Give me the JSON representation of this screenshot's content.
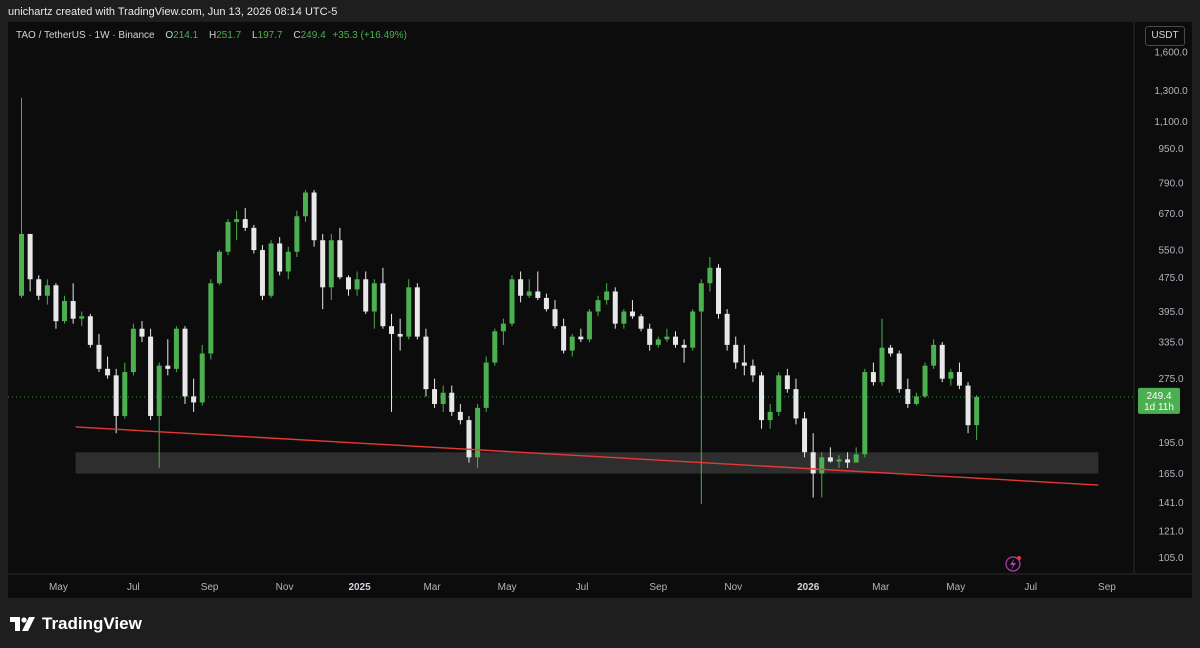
{
  "header": {
    "attribution": "unichartz created with TradingView.com, Jun 13, 2026 08:14 UTC-5"
  },
  "legend": {
    "symbol": "TAO / TetherUS · 1W · Binance",
    "open_label": "O",
    "open_value": "214.1",
    "high_label": "H",
    "high_value": "251.7",
    "low_label": "L",
    "low_value": "197.7",
    "close_label": "C",
    "close_value": "249.4",
    "change": "+35.3 (+16.49%)"
  },
  "currency_button": "USDT",
  "price_tag": {
    "price": "249.4",
    "countdown": "1d 11h"
  },
  "footer": {
    "brand": "TradingView"
  },
  "colors": {
    "up": "#4caf50",
    "down": "#e8e8e8",
    "trendline": "#e53935",
    "zone": "#3a3a3a",
    "last_price_line": "#4caf50"
  },
  "chart_data": {
    "type": "candlestick",
    "scale": "log",
    "timeframe": "1W",
    "ylim": [
      96,
      1880
    ],
    "y_ticks": [
      "1,600.0",
      "1,300.0",
      "1,100.0",
      "950.0",
      "790.0",
      "670.0",
      "550.0",
      "475.0",
      "395.0",
      "335.0",
      "275.0",
      "195.0",
      "165.0",
      "141.0",
      "121.0",
      "105.0"
    ],
    "x_ticks": [
      {
        "label": "May",
        "date": "2024-05-01",
        "bold": false
      },
      {
        "label": "Jul",
        "date": "2024-07-01",
        "bold": false
      },
      {
        "label": "Sep",
        "date": "2024-09-01",
        "bold": false
      },
      {
        "label": "Nov",
        "date": "2024-11-01",
        "bold": false
      },
      {
        "label": "2025",
        "date": "2025-01-01",
        "bold": true
      },
      {
        "label": "Mar",
        "date": "2025-03-01",
        "bold": false
      },
      {
        "label": "May",
        "date": "2025-05-01",
        "bold": false
      },
      {
        "label": "Jul",
        "date": "2025-07-01",
        "bold": false
      },
      {
        "label": "Sep",
        "date": "2025-09-01",
        "bold": false
      },
      {
        "label": "Nov",
        "date": "2025-11-01",
        "bold": false
      },
      {
        "label": "2026",
        "date": "2026-01-01",
        "bold": true
      },
      {
        "label": "Mar",
        "date": "2026-03-01",
        "bold": false
      },
      {
        "label": "May",
        "date": "2026-05-01",
        "bold": false
      },
      {
        "label": "Jul",
        "date": "2026-07-01",
        "bold": false
      },
      {
        "label": "Sep",
        "date": "2026-09-01",
        "bold": false
      }
    ],
    "xlim": [
      "2024-03-21",
      "2026-09-23"
    ],
    "last_price": 249.4,
    "candles": [
      {
        "date": "2024-04-01",
        "o": 430,
        "h": 1250,
        "l": 425,
        "c": 600
      },
      {
        "date": "2024-04-08",
        "o": 600,
        "h": 600,
        "l": 440,
        "c": 470
      },
      {
        "date": "2024-04-15",
        "o": 470,
        "h": 480,
        "l": 420,
        "c": 430
      },
      {
        "date": "2024-04-22",
        "o": 430,
        "h": 470,
        "l": 410,
        "c": 455
      },
      {
        "date": "2024-04-29",
        "o": 455,
        "h": 460,
        "l": 360,
        "c": 375
      },
      {
        "date": "2024-05-06",
        "o": 375,
        "h": 430,
        "l": 370,
        "c": 418
      },
      {
        "date": "2024-05-13",
        "o": 418,
        "h": 460,
        "l": 370,
        "c": 380
      },
      {
        "date": "2024-05-20",
        "o": 380,
        "h": 395,
        "l": 365,
        "c": 385
      },
      {
        "date": "2024-05-27",
        "o": 385,
        "h": 390,
        "l": 325,
        "c": 330
      },
      {
        "date": "2024-06-03",
        "o": 330,
        "h": 350,
        "l": 285,
        "c": 290
      },
      {
        "date": "2024-06-10",
        "o": 290,
        "h": 310,
        "l": 275,
        "c": 280
      },
      {
        "date": "2024-06-17",
        "o": 280,
        "h": 290,
        "l": 205,
        "c": 225
      },
      {
        "date": "2024-06-24",
        "o": 225,
        "h": 300,
        "l": 222,
        "c": 285
      },
      {
        "date": "2024-07-01",
        "o": 285,
        "h": 370,
        "l": 280,
        "c": 360
      },
      {
        "date": "2024-07-08",
        "o": 360,
        "h": 375,
        "l": 335,
        "c": 345
      },
      {
        "date": "2024-07-15",
        "o": 345,
        "h": 360,
        "l": 220,
        "c": 225
      },
      {
        "date": "2024-07-22",
        "o": 225,
        "h": 300,
        "l": 170,
        "c": 295
      },
      {
        "date": "2024-07-29",
        "o": 295,
        "h": 340,
        "l": 280,
        "c": 290
      },
      {
        "date": "2024-08-05",
        "o": 290,
        "h": 365,
        "l": 285,
        "c": 360
      },
      {
        "date": "2024-08-12",
        "o": 360,
        "h": 365,
        "l": 240,
        "c": 250
      },
      {
        "date": "2024-08-19",
        "o": 250,
        "h": 275,
        "l": 230,
        "c": 242
      },
      {
        "date": "2024-08-26",
        "o": 242,
        "h": 330,
        "l": 238,
        "c": 315
      },
      {
        "date": "2024-09-02",
        "o": 315,
        "h": 470,
        "l": 305,
        "c": 460
      },
      {
        "date": "2024-09-09",
        "o": 460,
        "h": 550,
        "l": 455,
        "c": 545
      },
      {
        "date": "2024-09-16",
        "o": 545,
        "h": 650,
        "l": 535,
        "c": 640
      },
      {
        "date": "2024-09-23",
        "o": 640,
        "h": 680,
        "l": 580,
        "c": 650
      },
      {
        "date": "2024-09-30",
        "o": 650,
        "h": 690,
        "l": 610,
        "c": 620
      },
      {
        "date": "2024-10-07",
        "o": 620,
        "h": 630,
        "l": 540,
        "c": 550
      },
      {
        "date": "2024-10-14",
        "o": 550,
        "h": 565,
        "l": 420,
        "c": 430
      },
      {
        "date": "2024-10-21",
        "o": 430,
        "h": 580,
        "l": 425,
        "c": 570
      },
      {
        "date": "2024-10-28",
        "o": 570,
        "h": 590,
        "l": 480,
        "c": 490
      },
      {
        "date": "2024-11-04",
        "o": 490,
        "h": 560,
        "l": 470,
        "c": 545
      },
      {
        "date": "2024-11-11",
        "o": 545,
        "h": 680,
        "l": 530,
        "c": 660
      },
      {
        "date": "2024-11-18",
        "o": 660,
        "h": 760,
        "l": 640,
        "c": 750
      },
      {
        "date": "2024-11-25",
        "o": 750,
        "h": 760,
        "l": 560,
        "c": 580
      },
      {
        "date": "2024-12-02",
        "o": 580,
        "h": 600,
        "l": 400,
        "c": 450
      },
      {
        "date": "2024-12-09",
        "o": 450,
        "h": 600,
        "l": 420,
        "c": 580
      },
      {
        "date": "2024-12-16",
        "o": 580,
        "h": 620,
        "l": 470,
        "c": 475
      },
      {
        "date": "2024-12-23",
        "o": 475,
        "h": 480,
        "l": 430,
        "c": 445
      },
      {
        "date": "2024-12-30",
        "o": 445,
        "h": 490,
        "l": 430,
        "c": 470
      },
      {
        "date": "2025-01-06",
        "o": 470,
        "h": 490,
        "l": 390,
        "c": 395
      },
      {
        "date": "2025-01-13",
        "o": 395,
        "h": 470,
        "l": 360,
        "c": 460
      },
      {
        "date": "2025-01-20",
        "o": 460,
        "h": 500,
        "l": 360,
        "c": 365
      },
      {
        "date": "2025-01-27",
        "o": 365,
        "h": 390,
        "l": 230,
        "c": 350
      },
      {
        "date": "2025-02-03",
        "o": 350,
        "h": 380,
        "l": 320,
        "c": 345
      },
      {
        "date": "2025-02-10",
        "o": 345,
        "h": 470,
        "l": 340,
        "c": 450
      },
      {
        "date": "2025-02-17",
        "o": 450,
        "h": 460,
        "l": 340,
        "c": 345
      },
      {
        "date": "2025-02-24",
        "o": 345,
        "h": 360,
        "l": 250,
        "c": 260
      },
      {
        "date": "2025-03-03",
        "o": 260,
        "h": 275,
        "l": 235,
        "c": 240
      },
      {
        "date": "2025-03-10",
        "o": 240,
        "h": 265,
        "l": 230,
        "c": 255
      },
      {
        "date": "2025-03-17",
        "o": 255,
        "h": 265,
        "l": 225,
        "c": 230
      },
      {
        "date": "2025-03-24",
        "o": 230,
        "h": 240,
        "l": 215,
        "c": 220
      },
      {
        "date": "2025-03-31",
        "o": 220,
        "h": 225,
        "l": 175,
        "c": 180
      },
      {
        "date": "2025-04-07",
        "o": 180,
        "h": 240,
        "l": 170,
        "c": 235
      },
      {
        "date": "2025-04-14",
        "o": 235,
        "h": 310,
        "l": 230,
        "c": 300
      },
      {
        "date": "2025-04-21",
        "o": 300,
        "h": 360,
        "l": 295,
        "c": 355
      },
      {
        "date": "2025-04-28",
        "o": 355,
        "h": 380,
        "l": 330,
        "c": 370
      },
      {
        "date": "2025-05-05",
        "o": 370,
        "h": 480,
        "l": 365,
        "c": 470
      },
      {
        "date": "2025-05-12",
        "o": 470,
        "h": 490,
        "l": 415,
        "c": 430
      },
      {
        "date": "2025-05-19",
        "o": 430,
        "h": 470,
        "l": 425,
        "c": 440
      },
      {
        "date": "2025-05-26",
        "o": 440,
        "h": 490,
        "l": 420,
        "c": 425
      },
      {
        "date": "2025-06-02",
        "o": 425,
        "h": 435,
        "l": 395,
        "c": 400
      },
      {
        "date": "2025-06-09",
        "o": 400,
        "h": 420,
        "l": 360,
        "c": 365
      },
      {
        "date": "2025-06-16",
        "o": 365,
        "h": 380,
        "l": 315,
        "c": 320
      },
      {
        "date": "2025-06-23",
        "o": 320,
        "h": 350,
        "l": 310,
        "c": 345
      },
      {
        "date": "2025-06-30",
        "o": 345,
        "h": 360,
        "l": 335,
        "c": 340
      },
      {
        "date": "2025-07-07",
        "o": 340,
        "h": 400,
        "l": 335,
        "c": 395
      },
      {
        "date": "2025-07-14",
        "o": 395,
        "h": 430,
        "l": 385,
        "c": 420
      },
      {
        "date": "2025-07-21",
        "o": 420,
        "h": 460,
        "l": 410,
        "c": 440
      },
      {
        "date": "2025-07-28",
        "o": 440,
        "h": 450,
        "l": 360,
        "c": 370
      },
      {
        "date": "2025-08-04",
        "o": 370,
        "h": 400,
        "l": 360,
        "c": 395
      },
      {
        "date": "2025-08-11",
        "o": 395,
        "h": 420,
        "l": 380,
        "c": 385
      },
      {
        "date": "2025-08-18",
        "o": 385,
        "h": 390,
        "l": 355,
        "c": 360
      },
      {
        "date": "2025-08-25",
        "o": 360,
        "h": 370,
        "l": 320,
        "c": 330
      },
      {
        "date": "2025-09-01",
        "o": 330,
        "h": 345,
        "l": 325,
        "c": 340
      },
      {
        "date": "2025-09-08",
        "o": 340,
        "h": 360,
        "l": 335,
        "c": 345
      },
      {
        "date": "2025-09-15",
        "o": 345,
        "h": 355,
        "l": 325,
        "c": 330
      },
      {
        "date": "2025-09-22",
        "o": 330,
        "h": 340,
        "l": 300,
        "c": 325
      },
      {
        "date": "2025-09-29",
        "o": 325,
        "h": 400,
        "l": 320,
        "c": 395
      },
      {
        "date": "2025-10-06",
        "o": 395,
        "h": 470,
        "l": 140,
        "c": 460
      },
      {
        "date": "2025-10-13",
        "o": 460,
        "h": 530,
        "l": 440,
        "c": 500
      },
      {
        "date": "2025-10-20",
        "o": 500,
        "h": 510,
        "l": 380,
        "c": 390
      },
      {
        "date": "2025-10-27",
        "o": 390,
        "h": 400,
        "l": 320,
        "c": 330
      },
      {
        "date": "2025-11-03",
        "o": 330,
        "h": 345,
        "l": 290,
        "c": 300
      },
      {
        "date": "2025-11-10",
        "o": 300,
        "h": 330,
        "l": 280,
        "c": 295
      },
      {
        "date": "2025-11-17",
        "o": 295,
        "h": 305,
        "l": 270,
        "c": 280
      },
      {
        "date": "2025-11-24",
        "o": 280,
        "h": 285,
        "l": 210,
        "c": 220
      },
      {
        "date": "2025-12-01",
        "o": 220,
        "h": 240,
        "l": 210,
        "c": 230
      },
      {
        "date": "2025-12-08",
        "o": 230,
        "h": 285,
        "l": 225,
        "c": 280
      },
      {
        "date": "2025-12-15",
        "o": 280,
        "h": 290,
        "l": 255,
        "c": 260
      },
      {
        "date": "2025-12-22",
        "o": 260,
        "h": 275,
        "l": 215,
        "c": 222
      },
      {
        "date": "2025-12-29",
        "o": 222,
        "h": 230,
        "l": 180,
        "c": 185
      },
      {
        "date": "2026-01-05",
        "o": 185,
        "h": 205,
        "l": 145,
        "c": 165
      },
      {
        "date": "2026-01-12",
        "o": 165,
        "h": 185,
        "l": 145,
        "c": 180
      },
      {
        "date": "2026-01-19",
        "o": 180,
        "h": 190,
        "l": 175,
        "c": 176
      },
      {
        "date": "2026-01-26",
        "o": 176,
        "h": 182,
        "l": 170,
        "c": 178
      },
      {
        "date": "2026-02-02",
        "o": 178,
        "h": 185,
        "l": 170,
        "c": 175
      },
      {
        "date": "2026-02-09",
        "o": 175,
        "h": 190,
        "l": 175,
        "c": 183
      },
      {
        "date": "2026-02-16",
        "o": 183,
        "h": 290,
        "l": 180,
        "c": 285
      },
      {
        "date": "2026-02-23",
        "o": 285,
        "h": 300,
        "l": 265,
        "c": 270
      },
      {
        "date": "2026-03-02",
        "o": 270,
        "h": 380,
        "l": 265,
        "c": 325
      },
      {
        "date": "2026-03-09",
        "o": 325,
        "h": 330,
        "l": 310,
        "c": 315
      },
      {
        "date": "2026-03-16",
        "o": 315,
        "h": 320,
        "l": 255,
        "c": 260
      },
      {
        "date": "2026-03-23",
        "o": 260,
        "h": 275,
        "l": 235,
        "c": 240
      },
      {
        "date": "2026-03-30",
        "o": 240,
        "h": 255,
        "l": 238,
        "c": 250
      },
      {
        "date": "2026-04-06",
        "o": 250,
        "h": 300,
        "l": 248,
        "c": 295
      },
      {
        "date": "2026-04-13",
        "o": 295,
        "h": 340,
        "l": 290,
        "c": 330
      },
      {
        "date": "2026-04-20",
        "o": 330,
        "h": 335,
        "l": 270,
        "c": 275
      },
      {
        "date": "2026-04-27",
        "o": 275,
        "h": 290,
        "l": 265,
        "c": 285
      },
      {
        "date": "2026-05-04",
        "o": 285,
        "h": 300,
        "l": 260,
        "c": 265
      },
      {
        "date": "2026-05-11",
        "o": 265,
        "h": 270,
        "l": 205,
        "c": 214.1
      },
      {
        "date": "2026-05-18",
        "o": 214.1,
        "h": 251.7,
        "l": 197.7,
        "c": 249.4
      }
    ],
    "trendline": {
      "start": {
        "date": "2024-05-15",
        "price": 212
      },
      "end": {
        "date": "2026-08-25",
        "price": 155
      }
    },
    "support_zone": {
      "start": "2024-05-15",
      "end": "2026-08-25",
      "top": 185,
      "bottom": 165
    }
  }
}
